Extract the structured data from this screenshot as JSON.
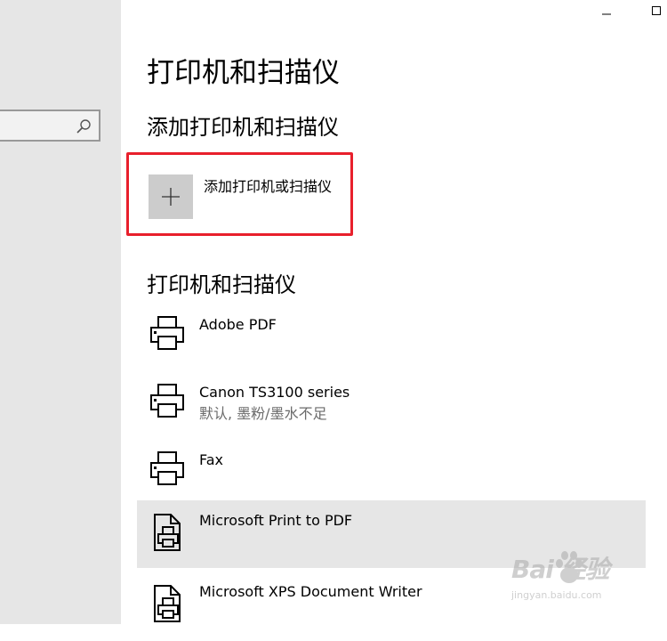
{
  "window": {
    "minimize_icon": "minimize-icon",
    "maximize_icon": "maximize-icon"
  },
  "sidebar": {
    "search_icon": "search-icon"
  },
  "page": {
    "title": "打印机和扫描仪"
  },
  "add_section": {
    "heading": "添加打印机和扫描仪",
    "button_label": "添加打印机或扫描仪",
    "button_icon": "plus-icon",
    "highlight_color": "#e8202c"
  },
  "devices_section": {
    "heading": "打印机和扫描仪",
    "devices": [
      {
        "name": "Adobe PDF",
        "status": "",
        "icon": "printer-icon"
      },
      {
        "name": "Canon TS3100 series",
        "status": "默认, 墨粉/墨水不足",
        "icon": "printer-icon"
      },
      {
        "name": "Fax",
        "status": "",
        "icon": "printer-icon"
      },
      {
        "name": "Microsoft Print to PDF",
        "status": "",
        "icon": "pdf-printer-icon",
        "selected": true
      },
      {
        "name": "Microsoft XPS Document Writer",
        "status": "",
        "icon": "pdf-printer-icon"
      }
    ]
  },
  "watermark": {
    "logo": "Bai  经验",
    "url": "jingyan.baidu.com"
  }
}
